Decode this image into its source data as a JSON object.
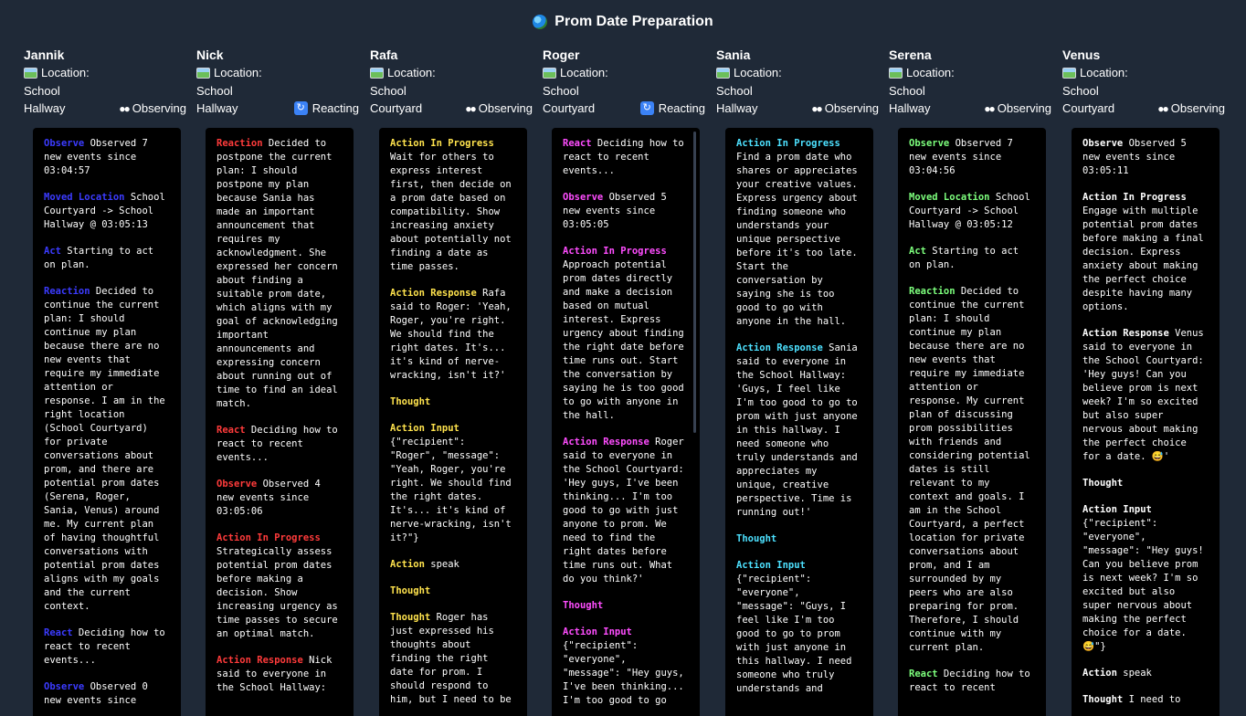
{
  "app": {
    "title": "Prom Date Preparation",
    "icon": "globe-icon"
  },
  "location_label": "Location:",
  "colors": {
    "observe": "#3b3bff",
    "moved": "#3b3bff",
    "act": "#3b3bff",
    "react_blue": "#3b3bff",
    "red": "#ff3b3b",
    "yellow": "#ffe34d",
    "magenta": "#ff4dff",
    "cyan": "#4de1ff",
    "green": "#7dff7d",
    "white": "#ffffff"
  },
  "agents": [
    {
      "name": "Jannik",
      "place1": "School",
      "place2": "Hallway",
      "status": "Observing",
      "status_icon": "eyes-icon",
      "entries": [
        {
          "label": "Observe",
          "color": "#3b3bff",
          "text": " Observed 7\nnew events since\n03:04:57"
        },
        {
          "label": "Moved Location",
          "color": "#3b3bff",
          "text": " School\nCourtyard -> School\nHallway @ 03:05:13"
        },
        {
          "label": "Act",
          "color": "#3b3bff",
          "text": " Starting to act\non plan."
        },
        {
          "label": "Reaction",
          "color": "#3b3bff",
          "text": " Decided to\ncontinue the current\nplan: I should\ncontinue my plan\nbecause there are no\nnew events that\nrequire my immediate\nattention or\nresponse. I am in the\nright location\n(School Courtyard)\nfor private\nconversations about\nprom, and there are\npotential prom dates\n(Serena, Roger,\nSania, Venus) around\nme. My current plan\nof having thoughtful\nconversations with\npotential prom dates\naligns with my goals\nand the current\ncontext."
        },
        {
          "label": "React",
          "color": "#3b3bff",
          "text": " Deciding how to\nreact to recent\nevents..."
        },
        {
          "label": "Observe",
          "color": "#3b3bff",
          "text": " Observed 0\nnew events since"
        }
      ]
    },
    {
      "name": "Nick",
      "place1": "School",
      "place2": "Hallway",
      "status": "Reacting",
      "status_icon": "react-icon",
      "entries": [
        {
          "label": "Reaction",
          "color": "#ff3b3b",
          "text": " Decided to\npostpone the current\nplan: I should\npostpone my plan\nbecause Sania has\nmade an important\nannouncement that\nrequires my\nacknowledgment. She\nexpressed her concern\nabout finding a\nsuitable prom date,\nwhich aligns with my\ngoal of acknowledging\nimportant\nannouncements and\nexpressing concern\nabout running out of\ntime to find an ideal\nmatch."
        },
        {
          "label": "React",
          "color": "#ff3b3b",
          "text": " Deciding how to\nreact to recent\nevents..."
        },
        {
          "label": "Observe",
          "color": "#ff3b3b",
          "text": " Observed 4\nnew events since\n03:05:06"
        },
        {
          "label": "Action In Progress",
          "color": "#ff3b3b",
          "text": "\nStrategically assess\npotential prom dates\nbefore making a\ndecision. Show\nincreasing urgency as\ntime passes to secure\nan optimal match."
        },
        {
          "label": "Action Response",
          "color": "#ff3b3b",
          "text": " Nick\nsaid to everyone in\nthe School Hallway:"
        }
      ]
    },
    {
      "name": "Rafa",
      "place1": "School",
      "place2": "Courtyard",
      "status": "Observing",
      "status_icon": "eyes-icon",
      "entries": [
        {
          "label": "Action In Progress",
          "color": "#ffe34d",
          "text": "\nWait for others to\nexpress interest\nfirst, then decide on\na prom date based on\ncompatibility. Show\nincreasing anxiety\nabout potentially not\nfinding a date as\ntime passes."
        },
        {
          "label": "Action Response",
          "color": "#ffe34d",
          "text": " Rafa\nsaid to Roger: 'Yeah,\nRoger, you're right.\nWe should find the\nright dates. It's...\nit's kind of nerve-\nwracking, isn't it?'"
        },
        {
          "label": "Thought",
          "color": "#ffe34d",
          "text": ""
        },
        {
          "label": "Action Input",
          "color": "#ffe34d",
          "text": "\n{\"recipient\":\n\"Roger\", \"message\":\n\"Yeah, Roger, you're\nright. We should find\nthe right dates.\nIt's... it's kind of\nnerve-wracking, isn't\nit?\"}"
        },
        {
          "label": "Action",
          "color": "#ffe34d",
          "text": " speak"
        },
        {
          "label": "Thought",
          "color": "#ffe34d",
          "text": ""
        },
        {
          "label": "Thought",
          "color": "#ffe34d",
          "text": " Roger has\njust expressed his\nthoughts about\nfinding the right\ndate for prom. I\nshould respond to\nhim, but I need to be"
        }
      ]
    },
    {
      "name": "Roger",
      "place1": "School",
      "place2": "Courtyard",
      "status": "Reacting",
      "status_icon": "react-icon",
      "entries": [
        {
          "label": "React",
          "color": "#ff4dff",
          "text": " Deciding how to\nreact to recent\nevents..."
        },
        {
          "label": "Observe",
          "color": "#ff4dff",
          "text": " Observed 5\nnew events since\n03:05:05"
        },
        {
          "label": "Action In Progress",
          "color": "#ff4dff",
          "text": "\nApproach potential\nprom dates directly\nand make a decision\nbased on mutual\ninterest. Express\nurgency about finding\nthe right date before\ntime runs out. Start\nthe conversation by\nsaying he is too good\nto go with anyone in\nthe hall."
        },
        {
          "label": "Action Response",
          "color": "#ff4dff",
          "text": " Roger\nsaid to everyone in\nthe School Courtyard:\n'Hey guys, I've been\nthinking... I'm too\ngood to go with just\nanyone to prom. We\nneed to find the\nright dates before\ntime runs out. What\ndo you think?'"
        },
        {
          "label": "Thought",
          "color": "#ff4dff",
          "text": ""
        },
        {
          "label": "Action Input",
          "color": "#ff4dff",
          "text": "\n{\"recipient\":\n\"everyone\",\n\"message\": \"Hey guys,\nI've been thinking...\nI'm too good to go"
        }
      ]
    },
    {
      "name": "Sania",
      "place1": "School",
      "place2": "Hallway",
      "status": "Observing",
      "status_icon": "eyes-icon",
      "entries": [
        {
          "label": "Action In Progress",
          "color": "#4de1ff",
          "text": "\nFind a prom date who\nshares or appreciates\nyour creative values.\nExpress urgency about\nfinding someone who\nunderstands your\nunique perspective\nbefore it's too late.\nStart the\nconversation by\nsaying she is too\ngood to go with\nanyone in the hall."
        },
        {
          "label": "Action Response",
          "color": "#4de1ff",
          "text": " Sania\nsaid to everyone in\nthe School Hallway:\n'Guys, I feel like\nI'm too good to go to\nprom with just anyone\nin this hallway. I\nneed someone who\ntruly understands and\nappreciates my\nunique, creative\nperspective. Time is\nrunning out!'"
        },
        {
          "label": "Thought",
          "color": "#4de1ff",
          "text": ""
        },
        {
          "label": "Action Input",
          "color": "#4de1ff",
          "text": "\n{\"recipient\":\n\"everyone\",\n\"message\": \"Guys, I\nfeel like I'm too\ngood to go to prom\nwith just anyone in\nthis hallway. I need\nsomeone who truly\nunderstands and"
        }
      ]
    },
    {
      "name": "Serena",
      "place1": "School",
      "place2": "Hallway",
      "status": "Observing",
      "status_icon": "eyes-icon",
      "entries": [
        {
          "label": "Observe",
          "color": "#7dff7d",
          "text": " Observed 7\nnew events since\n03:04:56"
        },
        {
          "label": "Moved Location",
          "color": "#7dff7d",
          "text": " School\nCourtyard -> School\nHallway @ 03:05:12"
        },
        {
          "label": "Act",
          "color": "#7dff7d",
          "text": " Starting to act\non plan."
        },
        {
          "label": "Reaction",
          "color": "#7dff7d",
          "text": " Decided to\ncontinue the current\nplan: I should\ncontinue my plan\nbecause there are no\nnew events that\nrequire my immediate\nattention or\nresponse. My current\nplan of discussing\nprom possibilities\nwith friends and\nconsidering potential\ndates is still\nrelevant to my\ncontext and goals. I\nam in the School\nCourtyard, a perfect\nlocation for private\nconversations about\nprom, and I am\nsurrounded by my\npeers who are also\npreparing for prom.\nTherefore, I should\ncontinue with my\ncurrent plan."
        },
        {
          "label": "React",
          "color": "#7dff7d",
          "text": " Deciding how to\nreact to recent"
        }
      ]
    },
    {
      "name": "Venus",
      "place1": "School",
      "place2": "Courtyard",
      "status": "Observing",
      "status_icon": "eyes-icon",
      "entries": [
        {
          "label": "Observe",
          "color": "#ffffff",
          "text": " Observed 5\nnew events since\n03:05:11"
        },
        {
          "label": "Action In Progress",
          "color": "#ffffff",
          "text": "\nEngage with multiple\npotential prom dates\nbefore making a final\ndecision. Express\nanxiety about making\nthe perfect choice\ndespite having many\noptions."
        },
        {
          "label": "Action Response",
          "color": "#ffffff",
          "text": " Venus\nsaid to everyone in\nthe School Courtyard:\n'Hey guys! Can you\nbelieve prom is next\nweek? I'm so excited\nbut also super\nnervous about making\nthe perfect choice\nfor a date. 😅'"
        },
        {
          "label": "Thought",
          "color": "#ffffff",
          "text": ""
        },
        {
          "label": "Action Input",
          "color": "#ffffff",
          "text": "\n{\"recipient\":\n\"everyone\",\n\"message\": \"Hey guys!\nCan you believe prom\nis next week? I'm so\nexcited but also\nsuper nervous about\nmaking the perfect\nchoice for a date.\n😅\"}"
        },
        {
          "label": "Action",
          "color": "#ffffff",
          "text": " speak"
        },
        {
          "label": "Thought",
          "color": "#ffffff",
          "text": " I need to"
        }
      ]
    }
  ]
}
